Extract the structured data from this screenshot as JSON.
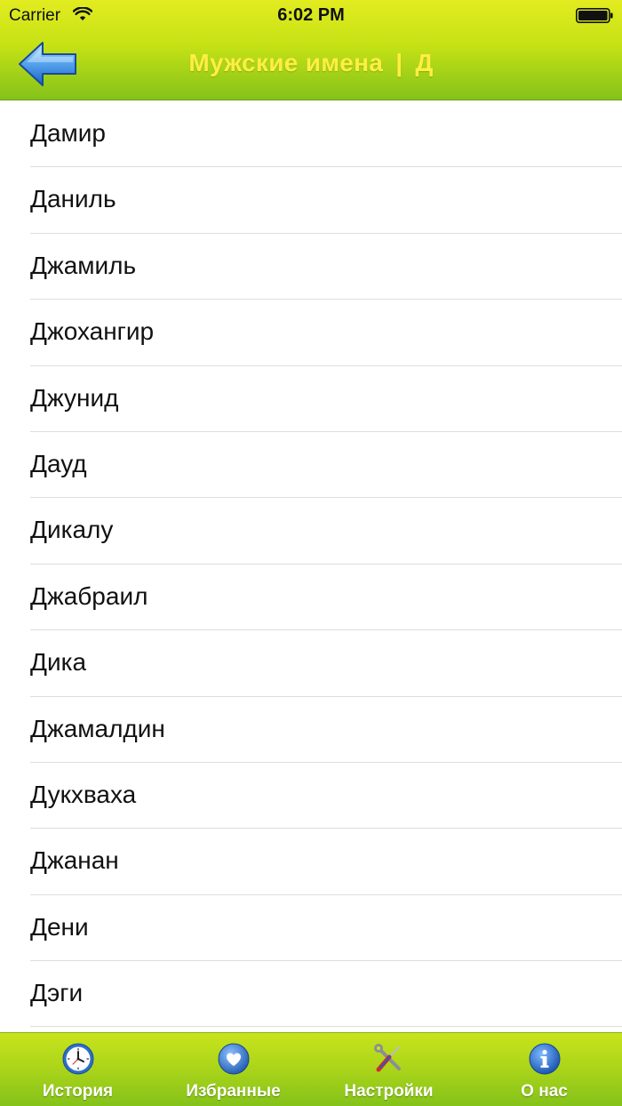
{
  "status_bar": {
    "carrier": "Carrier",
    "time": "6:02 PM"
  },
  "nav": {
    "title": "Мужские имена",
    "separator": "|",
    "letter": "Д",
    "back_icon": "back-arrow-icon",
    "title_color": "#ffee44"
  },
  "names": [
    "Дамир",
    "Даниль",
    "Джамиль",
    "Джохангир",
    "Джунид",
    "Дауд",
    "Дикалу",
    "Джабраил",
    "Дика",
    "Джамалдин",
    "Дукхваха",
    "Джанан",
    "Дени",
    "Дэги"
  ],
  "tabs": [
    {
      "label": "История",
      "icon": "clock-icon"
    },
    {
      "label": "Избранные",
      "icon": "heart-icon"
    },
    {
      "label": "Настройки",
      "icon": "tools-icon"
    },
    {
      "label": "О нас",
      "icon": "info-icon"
    }
  ],
  "colors": {
    "bar_green_top": "#e2ec20",
    "bar_green_bottom": "#84c21a",
    "separator": "#dedede"
  }
}
